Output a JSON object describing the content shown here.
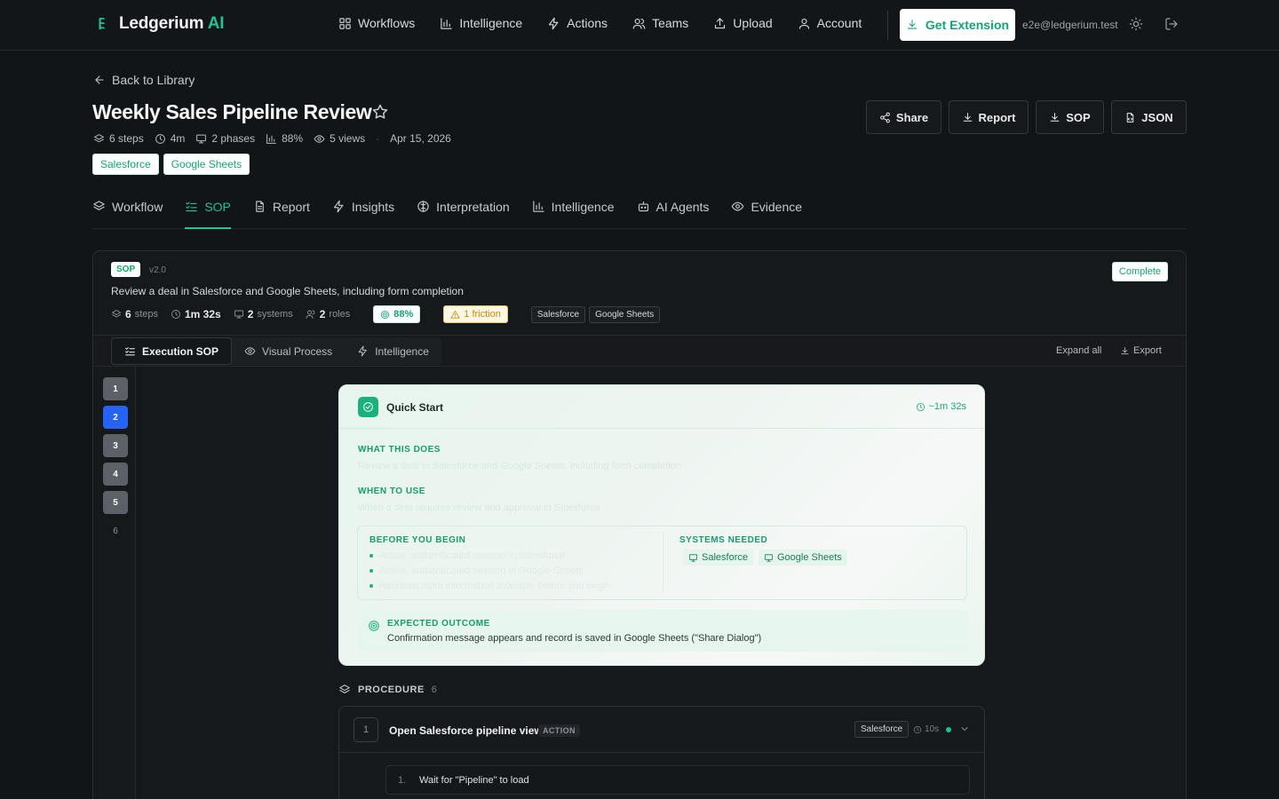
{
  "brand": {
    "name": "Ledgerium",
    "suffix": "AI"
  },
  "nav": [
    {
      "label": "Workflows",
      "icon": "grid-icon"
    },
    {
      "label": "Intelligence",
      "icon": "bar-chart-icon"
    },
    {
      "label": "Actions",
      "icon": "zap-icon"
    },
    {
      "label": "Teams",
      "icon": "users-icon"
    },
    {
      "label": "Upload",
      "icon": "upload-icon"
    },
    {
      "label": "Account",
      "icon": "user-icon"
    }
  ],
  "header_actions": {
    "get_extension": "Get Extension",
    "email": "e2e@ledgerium.test"
  },
  "page": {
    "back": "Back to Library",
    "title": "Weekly Sales Pipeline Review",
    "meta": {
      "steps": "6 steps",
      "duration": "4m",
      "phases": "2 phases",
      "score": "88%",
      "views": "5 views",
      "date": "Apr 15, 2026"
    },
    "tags": [
      "Salesforce",
      "Google Sheets"
    ],
    "actions": [
      "Share",
      "Report",
      "SOP",
      "JSON"
    ]
  },
  "tabs": [
    {
      "label": "Workflow",
      "icon": "layers-icon",
      "active": false
    },
    {
      "label": "SOP",
      "icon": "checklist-icon",
      "active": true
    },
    {
      "label": "Report",
      "icon": "file-text-icon",
      "active": false
    },
    {
      "label": "Insights",
      "icon": "zap-icon",
      "active": false
    },
    {
      "label": "Interpretation",
      "icon": "brain-icon",
      "active": false
    },
    {
      "label": "Intelligence",
      "icon": "bar-chart-icon",
      "active": false
    },
    {
      "label": "AI Agents",
      "icon": "bot-icon",
      "active": false
    },
    {
      "label": "Evidence",
      "icon": "eye-icon",
      "active": false
    }
  ],
  "sop": {
    "badge": "SOP",
    "version": "v2.0",
    "status": "Complete",
    "description": "Review a deal in Salesforce and Google Sheets, including form completion",
    "stats": {
      "steps_num": "6",
      "steps_label": "steps",
      "time": "1m 32s",
      "systems_num": "2",
      "systems_label": "systems",
      "roles_num": "2",
      "roles_label": "roles",
      "score": "88%",
      "friction": "1 friction"
    },
    "systems": [
      "Salesforce",
      "Google Sheets"
    ],
    "subtabs": [
      "Execution SOP",
      "Visual Process",
      "Intelligence"
    ],
    "expand_all": "Expand all",
    "export": "Export",
    "rail": [
      "1",
      "2",
      "3",
      "4",
      "5",
      "6"
    ]
  },
  "quick_start": {
    "title": "Quick Start",
    "time": "~1m 32s",
    "what_label": "WHAT THIS DOES",
    "what_text": "Review a deal in Salesforce and Google Sheets, including form completion",
    "when_label": "WHEN TO USE",
    "when_text": "When a deal requires review and approval in Salesforce",
    "before_label": "BEFORE YOU BEGIN",
    "before_items": [
      "Active, authenticated session in Salesforce",
      "Active, authenticated session in Google Sheets",
      "Required input information available before you begin"
    ],
    "systems_label": "SYSTEMS NEEDED",
    "outcome_label": "EXPECTED OUTCOME",
    "outcome_text": "Confirmation message appears and record is saved in Google Sheets (\"Share Dialog\")"
  },
  "procedure": {
    "label": "PROCEDURE",
    "count": "6",
    "step": {
      "index": "1",
      "title": "Open Salesforce pipeline view",
      "type": "ACTION",
      "system": "Salesforce",
      "duration": "10s",
      "substep_num": "1.",
      "substep_text": "Wait for \"Pipeline\" to load"
    }
  }
}
